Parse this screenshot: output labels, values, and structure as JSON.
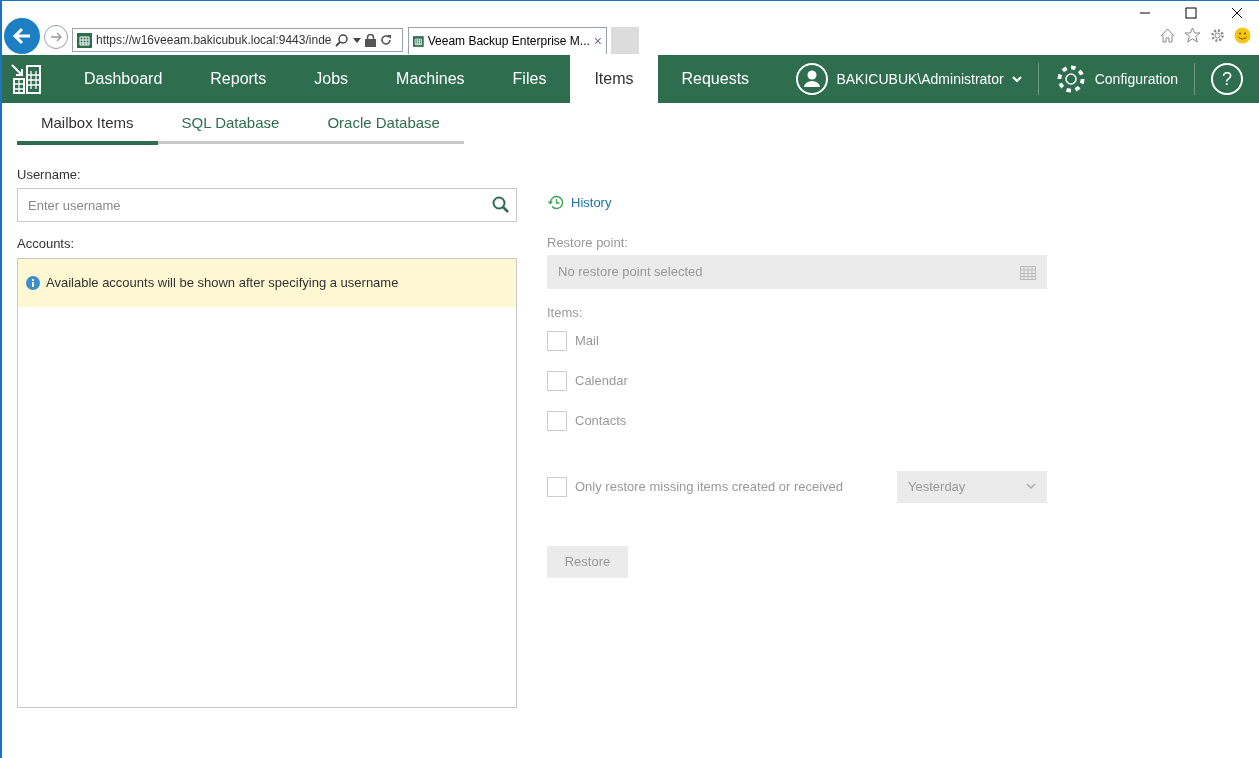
{
  "browser": {
    "url": "https://w16veeam.bakicubuk.local:9443/inde",
    "tab_title": "Veeam Backup Enterprise M...",
    "tab_close": "×"
  },
  "nav": {
    "items": [
      {
        "label": "Dashboard",
        "selected": false
      },
      {
        "label": "Reports",
        "selected": false
      },
      {
        "label": "Jobs",
        "selected": false
      },
      {
        "label": "Machines",
        "selected": false
      },
      {
        "label": "Files",
        "selected": false
      },
      {
        "label": "Items",
        "selected": true
      },
      {
        "label": "Requests",
        "selected": false
      }
    ],
    "user": "BAKICUBUK\\Administrator",
    "configuration": "Configuration",
    "help": "?"
  },
  "tabs": [
    {
      "label": "Mailbox Items",
      "selected": true
    },
    {
      "label": "SQL Database",
      "selected": false
    },
    {
      "label": "Oracle Database",
      "selected": false
    }
  ],
  "username": {
    "label": "Username:",
    "placeholder": "Enter username"
  },
  "accounts": {
    "label": "Accounts:",
    "notice": "Available accounts will be shown after specifying a username"
  },
  "history": "History",
  "restore_point": {
    "label": "Restore point:",
    "value": "No restore point selected"
  },
  "items": {
    "label": "Items:",
    "options": [
      {
        "label": "Mail",
        "checked": false
      },
      {
        "label": "Calendar",
        "checked": false
      },
      {
        "label": "Contacts",
        "checked": false
      }
    ]
  },
  "missing_items": {
    "label": "Only restore missing items created or received",
    "checked": false,
    "period": "Yesterday"
  },
  "restore_button": "Restore"
}
